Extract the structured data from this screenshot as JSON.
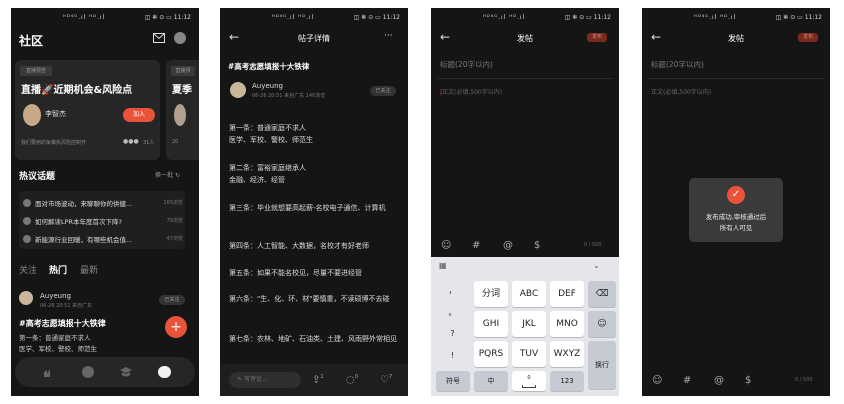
{
  "status": {
    "signal": "ᴴᴰ⁴ᴳ.ıl ᴴᴰ.ıl",
    "right": "◫ ✻ ⊙ ▭ 11:12"
  },
  "p1": {
    "title": "社区",
    "live_badge": "直播预告",
    "live_title": "直播🚀近期机会&风险点",
    "live_name": "李智杰",
    "join_label": "加入",
    "live_desc": "我们要用的争策执风险控制开",
    "live_count": "31人",
    "live2_badge": "直播预",
    "live2_title": "夏季",
    "live2_foot": "20",
    "hot_title": "热议话题",
    "hot_more": "换一批",
    "topics": [
      {
        "title": "面对市场波动，来聊聊你的供健...",
        "count": "165浏览"
      },
      {
        "title": "如何解读LPR本年度首次下降?",
        "count": "79浏览"
      },
      {
        "title": "新能源行业回暖，有哪些机会值...",
        "count": "47浏览"
      }
    ],
    "tabs": [
      "关注",
      "热门",
      "最新"
    ],
    "post_user": "Auyeung",
    "post_meta": "06-26 20:51 来自广东",
    "post_follow": "已关注",
    "post_title": "#高考志愿填报十大铁律",
    "post_line1": "第一条：普通家庭不求人",
    "post_line2": "医学、军校、警校、师范生",
    "fab": "+"
  },
  "p2": {
    "title": "帖子详情",
    "more": "···",
    "post_title": "#高考志愿填报十大铁律",
    "user": "Auyeung",
    "meta": "06-26 20:51 来自广东  146浏览",
    "follow": "已关注",
    "paras": [
      "第一条：普通家庭不求人\n医学、军校、警校、师范生",
      "第二条：富裕家庭继承人\n金融、经济、经管",
      "第三条：毕业就想要高起薪-名校电子通信、计算机",
      "第四条：人工智能、大数据，名校才有好老师",
      "第五条：如果不能名校见，尽量不要进经管",
      "第六条：\"生、化、环、材\"要慎重，不读硕博不去碰",
      "第七条：农林、地矿、石油类、土建、风雨野外常相见"
    ],
    "comment_placeholder": "写评论...",
    "share_count": "1",
    "comment_count": "0",
    "like_count": "7"
  },
  "p3": {
    "title": "发帖",
    "publish": "发布",
    "title_placeholder": "标题(20字以内)",
    "body_placeholder": "正文(必填,500字以内)",
    "counter": "0 / 500",
    "keys_left": [
      "，",
      "。",
      "?",
      "!"
    ],
    "keys": [
      [
        "分词",
        "ABC",
        "DEF"
      ],
      [
        "GHI",
        "JKL",
        "MNO"
      ],
      [
        "PQRS",
        "TUV",
        "WXYZ"
      ]
    ],
    "key_sym": "符号",
    "key_lang": "中",
    "key_space": "0",
    "key_num": "123",
    "key_enter": "换行"
  },
  "p4": {
    "title": "发帖",
    "publish": "发布",
    "title_placeholder": "标题(20字以内)",
    "body_placeholder": "正文(必填,500字以内)",
    "toast_line1": "发布成功,审核通过后",
    "toast_line2": "所有人可见",
    "counter": "0 / 500"
  },
  "colors": {
    "accent": "#e8533a",
    "bg": "#151515",
    "card": "#232323"
  }
}
